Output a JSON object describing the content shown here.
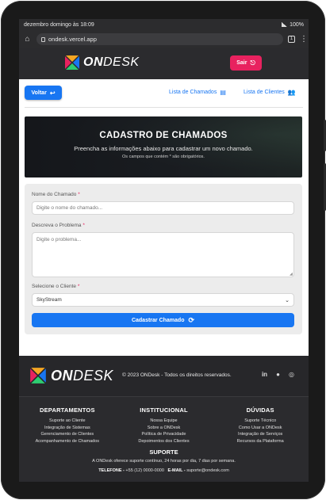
{
  "status_bar": {
    "datetime": "dezembro domingo às 18:09",
    "battery": "100%"
  },
  "browser": {
    "url": "ondesk.vercel.app",
    "tab_count": "1"
  },
  "header": {
    "brand_on": "ON",
    "brand_desk": "DESK",
    "logout_label": "Sair"
  },
  "nav": {
    "back_label": "Voltar",
    "tickets_list_label": "Lista de Chamados",
    "clients_list_label": "Lista de Clientes"
  },
  "hero": {
    "title": "CADASTRO DE CHAMADOS",
    "subtitle": "Preencha as informações abaixo para cadastrar um novo chamado.",
    "note": "Os campos que contém * são obrigatórios."
  },
  "form": {
    "name_label": "Nome do Chamado",
    "name_placeholder": "Digite o nome do chamado...",
    "problem_label": "Descreva o Problema",
    "problem_placeholder": "Digite o problema...",
    "client_label": "Selecione o Cliente",
    "client_selected": "SkyStream",
    "required_mark": "*",
    "submit_label": "Cadastrar Chamado"
  },
  "footer": {
    "brand_on": "ON",
    "brand_desk": "DESK",
    "copyright": "© 2023 ONDesk - Todos os direitos reservados.",
    "columns": [
      {
        "title": "DEPARTAMENTOS",
        "items": [
          "Suporte ao Cliente",
          "Integração de Sistemas",
          "Gerenciamento de Clientes",
          "Acompanhamento de Chamados"
        ]
      },
      {
        "title": "INSTITUCIONAL",
        "items": [
          "Nossa Equipe",
          "Sobre a ONDesk",
          "Política de Privacidade",
          "Depoimentos dos Clientes"
        ]
      },
      {
        "title": "DÚVIDAS",
        "items": [
          "Suporte Técnico",
          "Como Usar a ONDesk",
          "Integração de Serviços",
          "Recursos da Plataforma"
        ]
      }
    ],
    "support_title": "SUPORTE",
    "support_text": "A ONDesk oferece suporte contínuo, 24 horas por dia, 7 dias por semana.",
    "phone_label": "TELEFONE -",
    "phone": "+55 (12) 0000-0000",
    "email_label": "E-MAIL -",
    "email": "suporte@ondesk.com"
  },
  "colors": {
    "accent": "#1876f2",
    "danger": "#e8225f",
    "dark": "#2b2b2e"
  }
}
